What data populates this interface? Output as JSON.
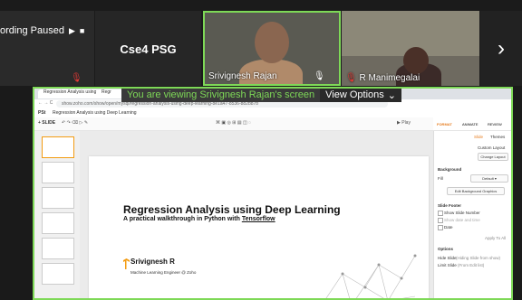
{
  "meeting": {
    "recording_status": "ording Paused",
    "psg_tile_name": "Cse4 PSG",
    "speaker_name": "Srivignesh Rajan",
    "participant2_name": "R Manimegalai",
    "next_glyph": "›"
  },
  "share_banner": {
    "text": "You are viewing Srivignesh Rajan's screen",
    "options_label": "View Options",
    "options_chevron": "⌄"
  },
  "browser": {
    "tab1": "Regression Analysis using Dee ×",
    "tab2": "Regr",
    "url": "show.zoho.com/show/open/mysql/regression-analysis-using-deep-learning-8e1a47-8536-882b87b"
  },
  "app": {
    "title_prefix": "PSt",
    "doc_title": "Regression Analysis using Deep Learning"
  },
  "toolbar": {
    "slide_label": "+ SLIDE",
    "play_label": "▶ Play"
  },
  "slide": {
    "title": "Regression Analysis using Deep Learning",
    "subtitle_prefix": "A practical walkthrough in Python with ",
    "subtitle_link": "Tensorflow",
    "author": "Srivignesh R",
    "author_role": "Machine Learning Engineer @ Zoho"
  },
  "properties": {
    "tabs": {
      "format": "FORMAT",
      "animate": "ANIMATE",
      "review": "REVIEW"
    },
    "sub_slide": "Slide",
    "sub_themes": "Themes",
    "custom_layout": "Custom Layout",
    "change_layout": "Change Layout",
    "background": "Background",
    "fill": "Fill",
    "fill_value": "Default ▾",
    "edit_background": "Edit Background Graphics",
    "slide_footer": "Slide Footer",
    "show_slide_number": "Show Slide Number",
    "date_time": "Show date and time",
    "date_label": "Date",
    "apply_to_all": "Apply To All",
    "options": "Options",
    "hide_slide": "Hide Slide",
    "hide_slide_detail": "(Hiding Slide from show)",
    "limit_slide": "Limit Slide",
    "limit_detail": "(From Edit list)"
  },
  "colors": {
    "active_speaker": "#7ed957",
    "muted": "#e53935",
    "accent": "#e67e22"
  }
}
